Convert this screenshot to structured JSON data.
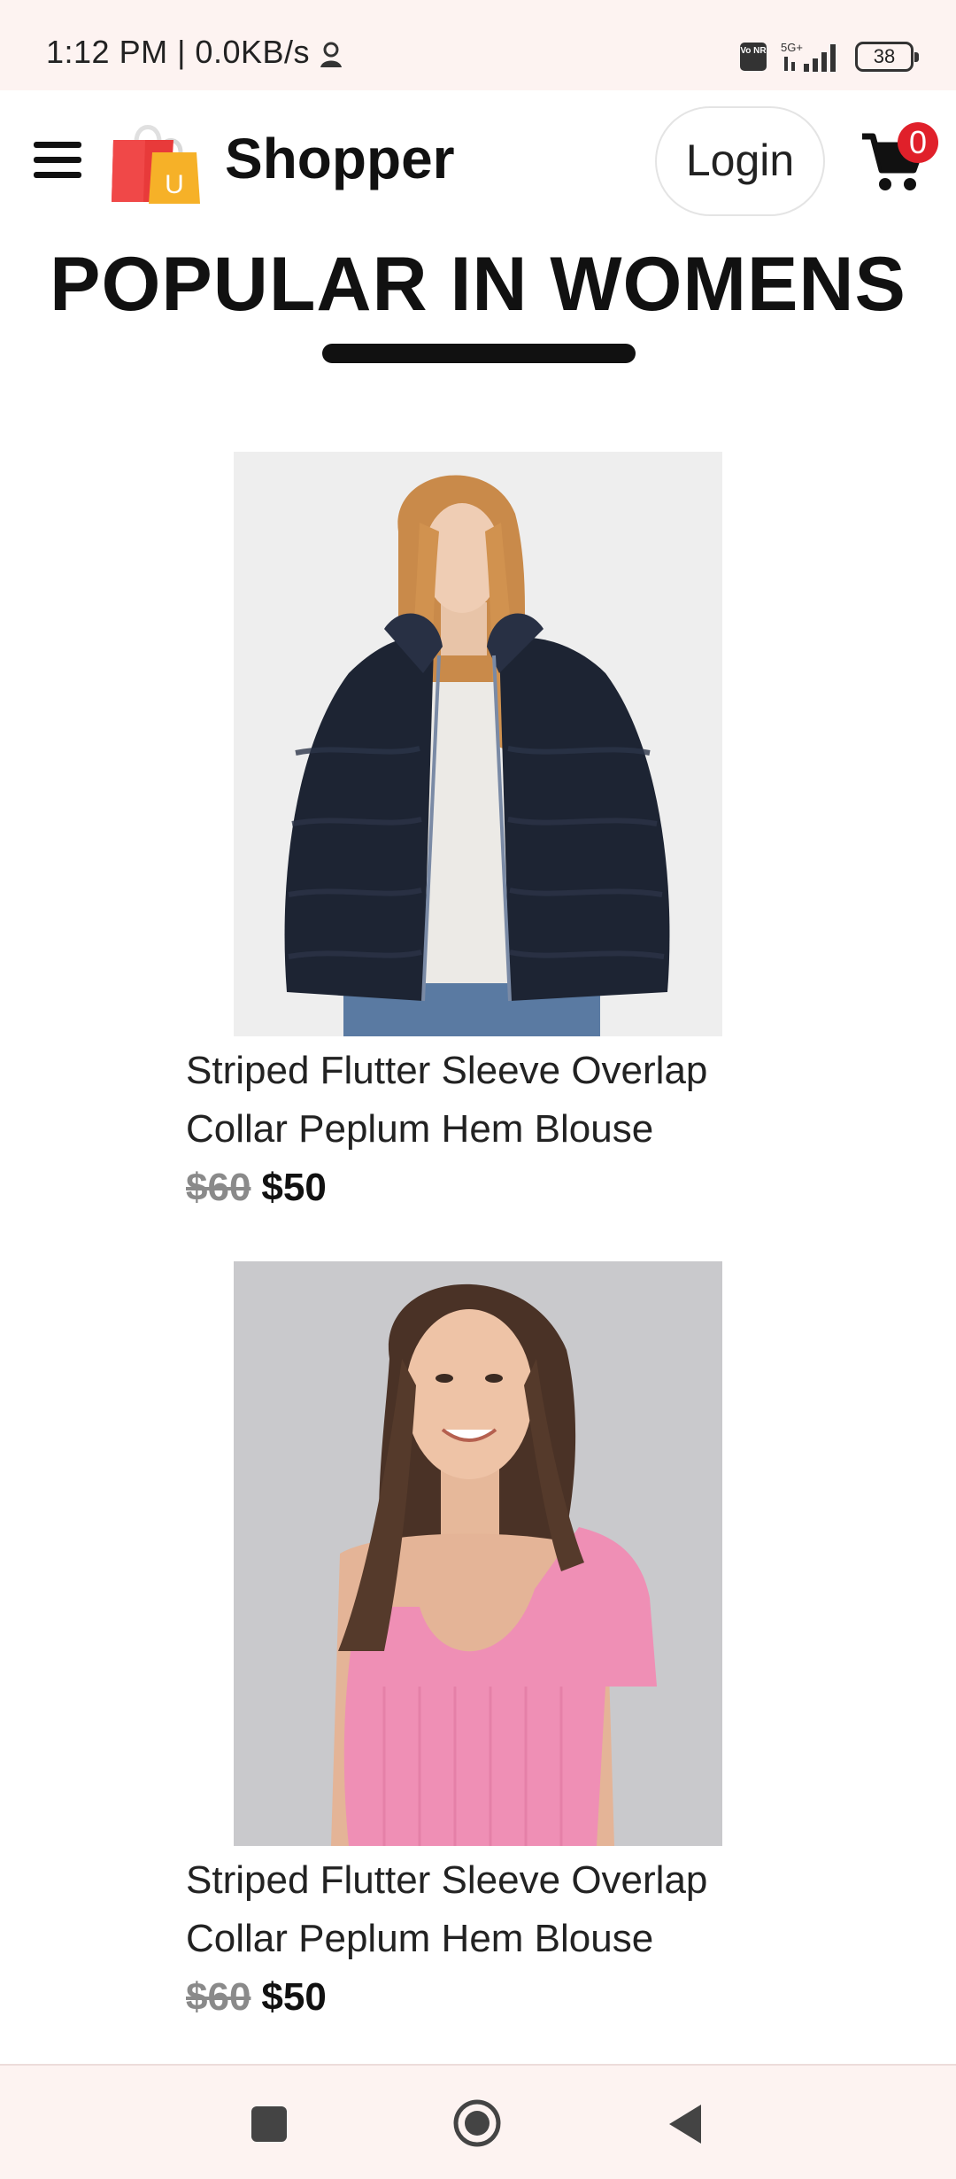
{
  "status_bar": {
    "time_text": "1:12 PM | 0.0KB/s",
    "network_label": "5G+",
    "volte_label": "Vo NR",
    "battery_level": "38"
  },
  "navbar": {
    "brand": "Shopper",
    "login_label": "Login",
    "cart_count": "0",
    "logo_letter": "U"
  },
  "section": {
    "title": "POPULAR IN WOMENS"
  },
  "products": [
    {
      "name": "Striped Flutter Sleeve Overlap Collar Peplum Hem Blouse",
      "old_price": "$60",
      "new_price": "$50"
    },
    {
      "name": "Striped Flutter Sleeve Overlap Collar Peplum Hem Blouse",
      "old_price": "$60",
      "new_price": "$50"
    }
  ],
  "colors": {
    "accent_red": "#e0202a",
    "status_bg": "#fdf3f1"
  },
  "icons": [
    "person-icon",
    "signal-icon",
    "battery-icon",
    "menu-icon",
    "shopping-bag-logo-icon",
    "cart-icon",
    "recents-icon",
    "home-icon",
    "back-icon"
  ]
}
